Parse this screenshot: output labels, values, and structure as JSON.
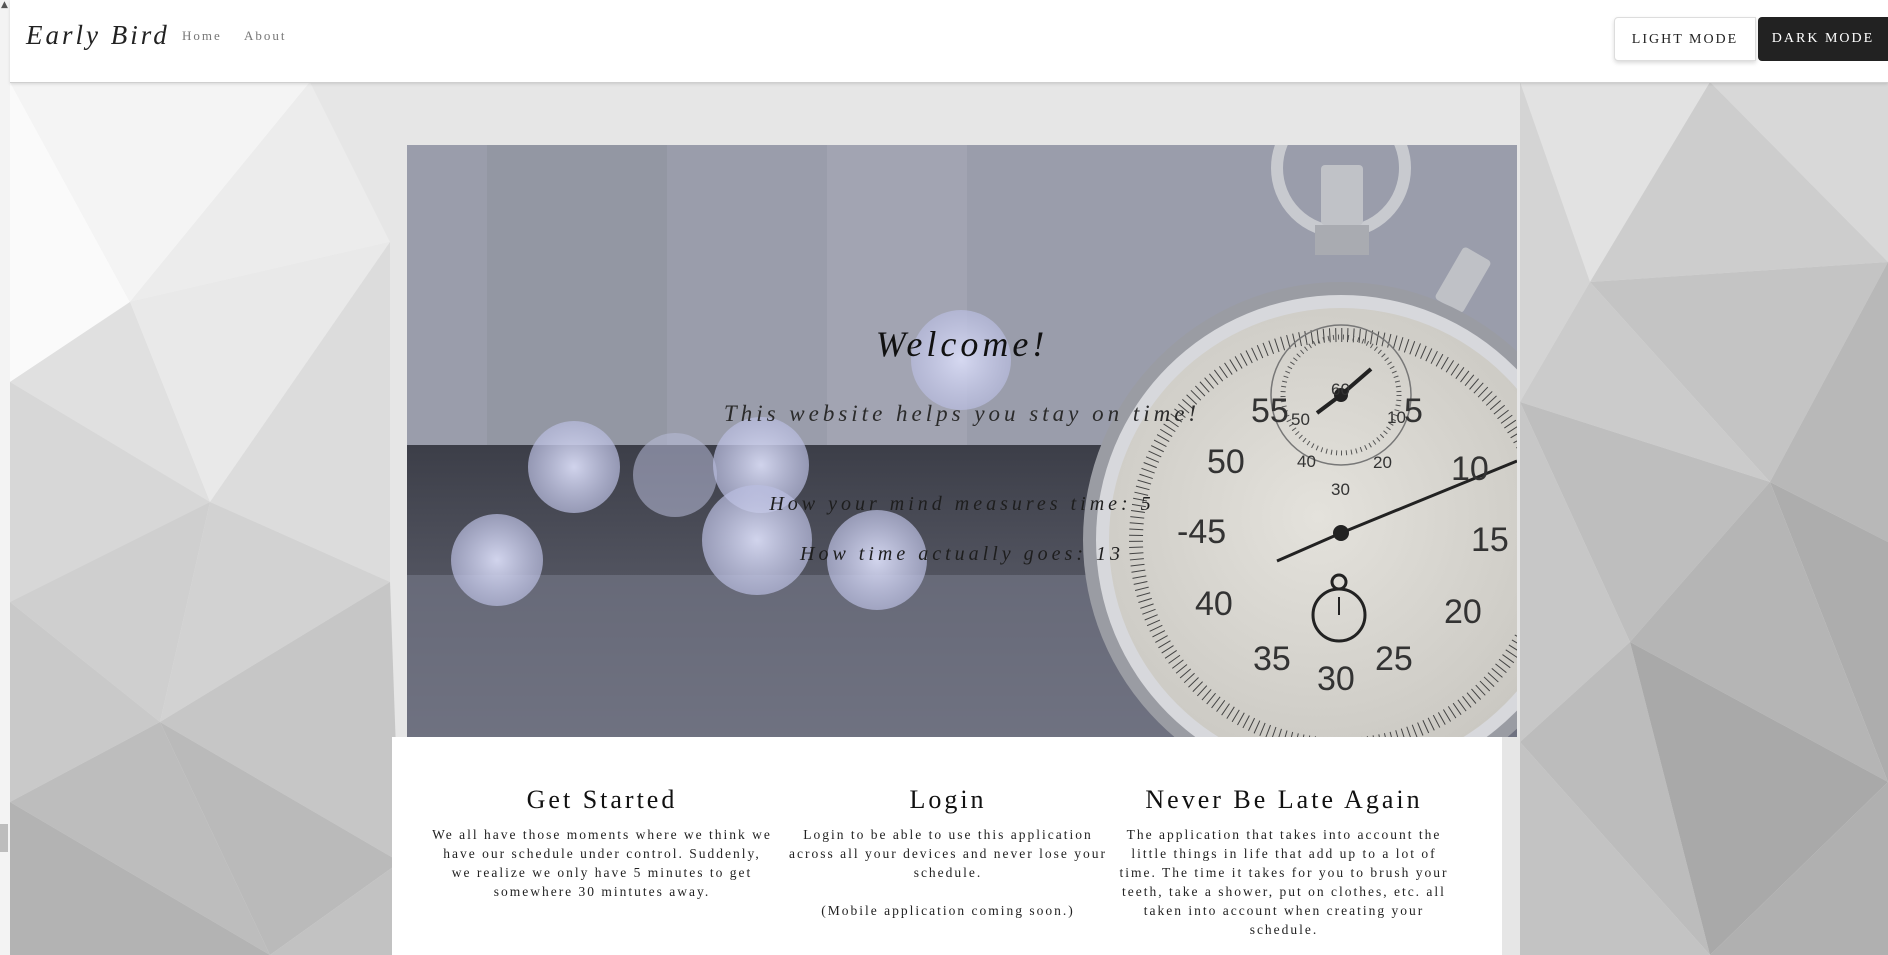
{
  "navbar": {
    "brand": "Early Bird",
    "links": [
      "Home",
      "About"
    ],
    "light_mode_label": "LIGHT MODE",
    "dark_mode_label": "DARK MODE"
  },
  "hero": {
    "title": "Welcome!",
    "subtitle": "This website helps you stay on time!",
    "mind_time": "How your mind measures time: 5",
    "actual_time": "How time actually goes: 13",
    "stopwatch": {
      "outer_numbers": [
        "55",
        "5",
        "10",
        "15",
        "20",
        "25",
        "30",
        "35",
        "40",
        "45",
        "50"
      ],
      "inner_numbers": [
        "60",
        "10",
        "20",
        "30",
        "40",
        "50"
      ]
    }
  },
  "features": [
    {
      "title": "Get Started",
      "text": [
        "We all have those moments where we think we have our schedule under control. Suddenly, we realize we only have 5 minutes to get somewhere 30 mintutes away."
      ]
    },
    {
      "title": "Login",
      "text": [
        "Login to be able to use this application across all your devices and never lose your schedule.",
        "(Mobile application coming soon.)"
      ]
    },
    {
      "title": "Never Be Late Again",
      "text": [
        "The application that takes into account the little things in life that add up to a lot of time. The time it takes for you to brush your teeth, take a shower, put on clothes, etc. all taken into account when creating your schedule."
      ]
    }
  ],
  "colors": {
    "dark_button": "#222222",
    "navbar_bg": "#ffffff",
    "page_bg": "#e9e9e9"
  }
}
